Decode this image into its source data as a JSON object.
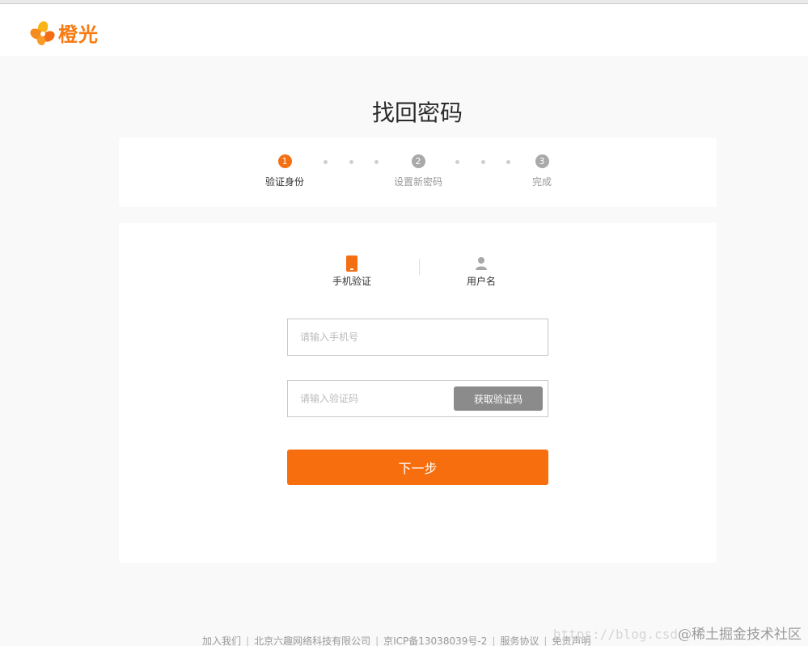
{
  "brand": {
    "name": "橙光",
    "accent_color": "#f76e0f",
    "logo_icon": "flower-logo-icon"
  },
  "page_title": "找回密码",
  "steps": [
    {
      "num": "1",
      "label": "验证身份",
      "state": "active"
    },
    {
      "num": "2",
      "label": "设置新密码",
      "state": "inactive"
    },
    {
      "num": "3",
      "label": "完成",
      "state": "inactive"
    }
  ],
  "tabs": [
    {
      "label": "手机验证",
      "icon": "phone-icon",
      "selected": true
    },
    {
      "label": "用户名",
      "icon": "user-icon",
      "selected": false
    }
  ],
  "form": {
    "phone_placeholder": "请输入手机号",
    "code_placeholder": "请输入验证码",
    "get_code_label": "获取验证码",
    "next_label": "下一步"
  },
  "footer": {
    "links": [
      "加入我们",
      "北京六趣网络科技有限公司",
      "京ICP备13038039号-2",
      "服务协议",
      "免责声明"
    ]
  },
  "watermark": {
    "url": "https://blog.csd",
    "source": "@稀土掘金技术社区"
  }
}
